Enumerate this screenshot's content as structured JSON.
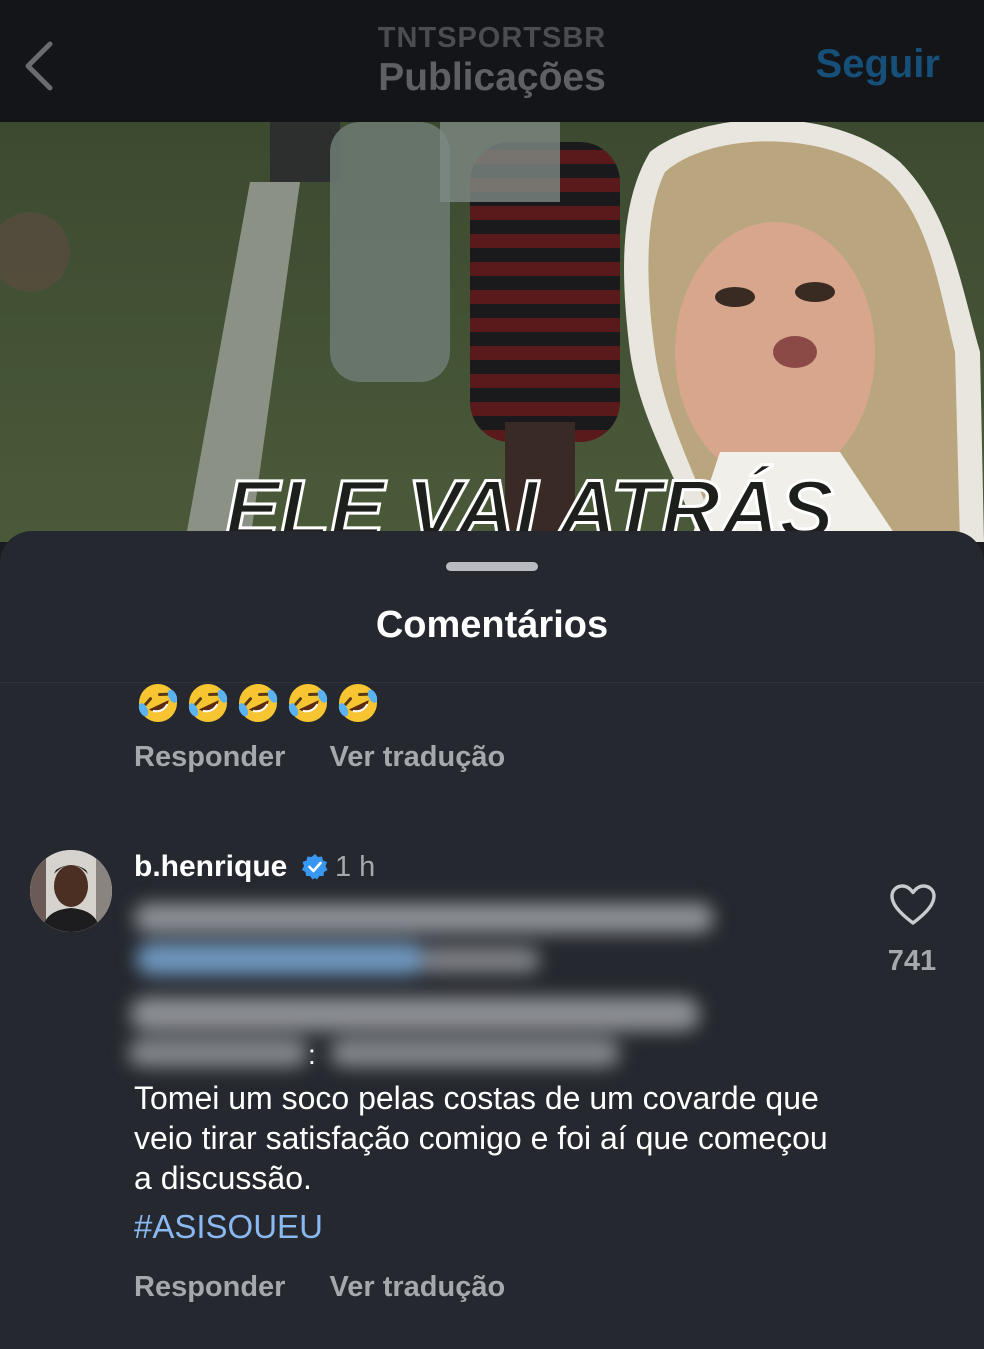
{
  "header": {
    "account": "TNTSPORTSBR",
    "title": "Publicações",
    "follow_label": "Seguir"
  },
  "video": {
    "caption": "ELE VAI ATRÁS"
  },
  "sheet": {
    "title": "Comentários"
  },
  "comments": [
    {
      "emojis": [
        "rolling-on-floor-laughing",
        "rolling-on-floor-laughing",
        "rolling-on-floor-laughing",
        "rolling-on-floor-laughing",
        "rolling-on-floor-laughing"
      ],
      "reply_label": "Responder",
      "translate_label": "Ver tradução"
    },
    {
      "username": "b.henrique",
      "verified": true,
      "time": "1 h",
      "colon": ":",
      "text": "Tomei um soco pelas costas de um covarde que veio tirar satisfação comigo e foi aí que começou a discussão.",
      "hashtag": "#ASISOUEU",
      "reply_label": "Responder",
      "translate_label": "Ver tradução",
      "likes": "741"
    }
  ],
  "colors": {
    "background": "#1b1c1f",
    "sheet": "#25282e",
    "follow": "#164f78",
    "hashtag": "#8ab8f0",
    "verified": "#3897f0"
  }
}
